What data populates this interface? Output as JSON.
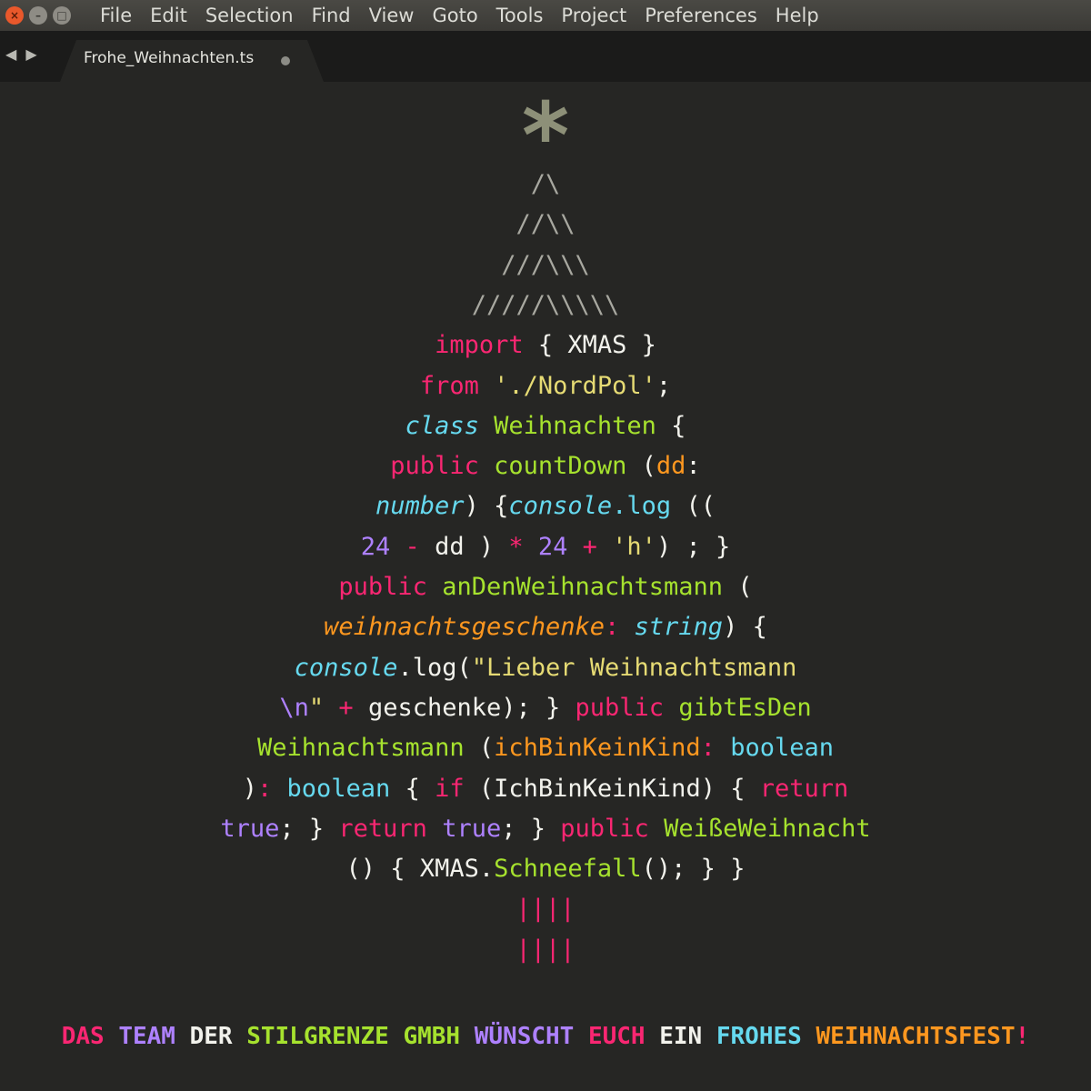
{
  "menubar": {
    "window_buttons": [
      "close-icon",
      "minimize-icon",
      "maximize-icon"
    ],
    "items": [
      "File",
      "Edit",
      "Selection",
      "Find",
      "View",
      "Goto",
      "Tools",
      "Project",
      "Preferences",
      "Help"
    ]
  },
  "tabbar": {
    "nav_back": "◀",
    "nav_forward": "▶",
    "tab_title": "Frohe_Weihnachten.ts"
  },
  "colors": {
    "background": "#262624",
    "keyword": "#f92672",
    "string": "#e6db74",
    "function": "#a6e22e",
    "type": "#66d9ef",
    "param": "#fd971f",
    "number": "#ae81ff",
    "star": "#8d9078"
  },
  "code": {
    "star": "*",
    "lines": [
      [
        {
          "t": "/\\",
          "c": "gray"
        }
      ],
      [
        {
          "t": "//\\\\",
          "c": "gray"
        }
      ],
      [
        {
          "t": "///\\\\\\",
          "c": "gray"
        }
      ],
      [
        {
          "t": "/////\\\\\\\\\\",
          "c": "gray"
        }
      ],
      [
        {
          "t": "import",
          "c": "pink"
        },
        {
          "t": " { XMAS }",
          "c": "white"
        }
      ],
      [
        {
          "t": "from",
          "c": "pink"
        },
        {
          "t": " './NordPol'",
          "c": "yellow"
        },
        {
          "t": ";",
          "c": "white"
        }
      ],
      [
        {
          "t": "class",
          "c": "blue",
          "i": true
        },
        {
          "t": " Weihnachten",
          "c": "green"
        },
        {
          "t": " {",
          "c": "white"
        }
      ],
      [
        {
          "t": "public",
          "c": "pink"
        },
        {
          "t": " countDown",
          "c": "green"
        },
        {
          "t": " (",
          "c": "white"
        },
        {
          "t": "dd",
          "c": "orange"
        },
        {
          "t": ":",
          "c": "white"
        }
      ],
      [
        {
          "t": "number",
          "c": "blue",
          "i": true
        },
        {
          "t": ") {",
          "c": "white"
        },
        {
          "t": "console",
          "c": "blue",
          "i": true
        },
        {
          "t": ".log",
          "c": "blue"
        },
        {
          "t": " ((",
          "c": "white"
        }
      ],
      [
        {
          "t": "24",
          "c": "purple"
        },
        {
          "t": " - ",
          "c": "pink"
        },
        {
          "t": "dd ) ",
          "c": "white"
        },
        {
          "t": "*",
          "c": "pink"
        },
        {
          "t": " 24",
          "c": "purple"
        },
        {
          "t": " + ",
          "c": "pink"
        },
        {
          "t": "'h'",
          "c": "yellow"
        },
        {
          "t": ") ; }",
          "c": "white"
        }
      ],
      [
        {
          "t": "public",
          "c": "pink"
        },
        {
          "t": " anDenWeihnachtsmann",
          "c": "green"
        },
        {
          "t": " (",
          "c": "white"
        }
      ],
      [
        {
          "t": "weihnachtsgeschenke",
          "c": "orange",
          "i": true
        },
        {
          "t": ": ",
          "c": "pink"
        },
        {
          "t": "string",
          "c": "blue",
          "i": true
        },
        {
          "t": ") {",
          "c": "white"
        }
      ],
      [
        {
          "t": "console",
          "c": "blue",
          "i": true
        },
        {
          "t": ".log(",
          "c": "white"
        },
        {
          "t": "\"Lieber Weihnachtsmann",
          "c": "yellow"
        }
      ],
      [
        {
          "t": "\\n",
          "c": "purple"
        },
        {
          "t": "\"",
          "c": "yellow"
        },
        {
          "t": " + ",
          "c": "pink"
        },
        {
          "t": "geschenke); } ",
          "c": "white"
        },
        {
          "t": "public",
          "c": "pink"
        },
        {
          "t": " gibtEsDen",
          "c": "green"
        }
      ],
      [
        {
          "t": "Weihnachtsmann",
          "c": "green"
        },
        {
          "t": " (",
          "c": "white"
        },
        {
          "t": "ichBinKeinKind",
          "c": "orange"
        },
        {
          "t": ": ",
          "c": "pink"
        },
        {
          "t": "boolean",
          "c": "blue"
        }
      ],
      [
        {
          "t": ")",
          "c": "white"
        },
        {
          "t": ": ",
          "c": "pink"
        },
        {
          "t": "boolean",
          "c": "blue"
        },
        {
          "t": " { ",
          "c": "white"
        },
        {
          "t": "if",
          "c": "pink"
        },
        {
          "t": " (IchBinKeinKind) { ",
          "c": "white"
        },
        {
          "t": "return",
          "c": "pink"
        }
      ],
      [
        {
          "t": "true",
          "c": "purple"
        },
        {
          "t": "; } ",
          "c": "white"
        },
        {
          "t": "return",
          "c": "pink"
        },
        {
          "t": " true",
          "c": "purple"
        },
        {
          "t": "; } ",
          "c": "white"
        },
        {
          "t": "public",
          "c": "pink"
        },
        {
          "t": " WeißeWeihnacht",
          "c": "green"
        }
      ],
      [
        {
          "t": "() { XMAS.",
          "c": "white"
        },
        {
          "t": "Schneefall",
          "c": "green"
        },
        {
          "t": "(); } }",
          "c": "white"
        }
      ],
      [
        {
          "t": "||||",
          "c": "pink"
        }
      ],
      [
        {
          "t": "||||",
          "c": "pink"
        }
      ]
    ]
  },
  "footer": [
    {
      "t": "DAS",
      "c": "pink"
    },
    {
      "t": "TEAM",
      "c": "purple"
    },
    {
      "t": "DER",
      "c": "white"
    },
    {
      "t": "STILGRENZE",
      "c": "green"
    },
    {
      "t": "GMBH",
      "c": "green"
    },
    {
      "t": "WÜNSCHT",
      "c": "purple"
    },
    {
      "t": "EUCH",
      "c": "pink"
    },
    {
      "t": "EIN",
      "c": "white"
    },
    {
      "t": "FROHES",
      "c": "blue"
    },
    {
      "t": "WEIHNACHTSFEST",
      "c": "orange"
    },
    {
      "t": "!",
      "c": "pink"
    }
  ]
}
